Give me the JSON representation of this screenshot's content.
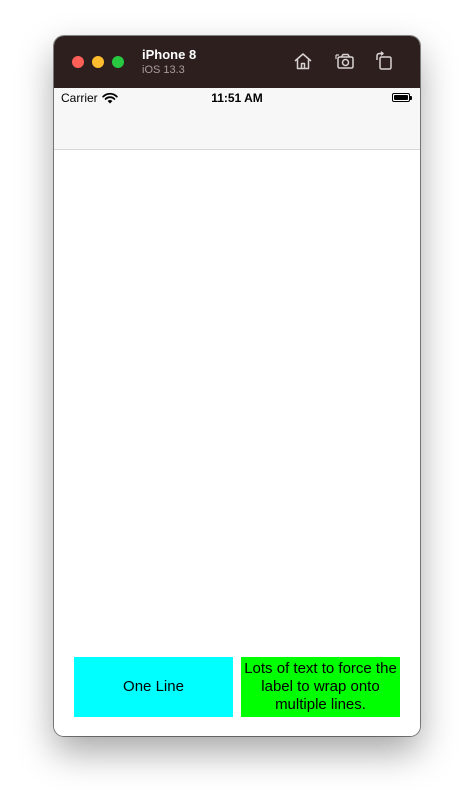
{
  "window": {
    "device_name": "iPhone 8",
    "os_version": "iOS 13.3",
    "icons": [
      "home-icon",
      "screenshot-icon",
      "rotate-icon"
    ]
  },
  "status_bar": {
    "carrier": "Carrier",
    "time": "11:51 AM",
    "icons": [
      "wifi-icon",
      "battery-icon"
    ]
  },
  "labels": {
    "one_line": "One Line",
    "multi_line": "Lots of text to force the label to wrap onto multiple lines."
  },
  "colors": {
    "titlebar": "#2e1f1f",
    "label_one_bg": "#00ffff",
    "label_multi_bg": "#00ff00",
    "close": "#fe5f57",
    "minimize": "#febc2e",
    "maximize": "#28c840"
  }
}
